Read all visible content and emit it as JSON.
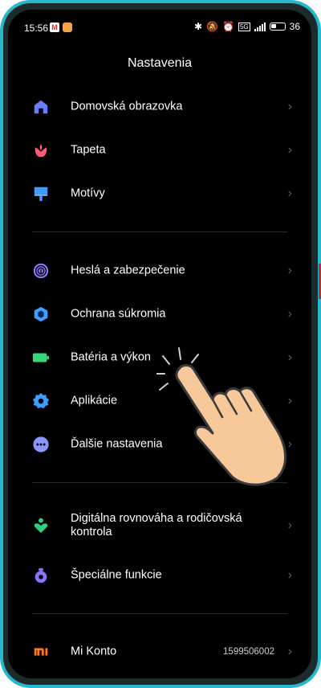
{
  "status_bar": {
    "time": "15:56",
    "network": "5G",
    "battery": "36"
  },
  "header": {
    "title": "Nastavenia"
  },
  "groups": [
    {
      "items": [
        {
          "label": "Domovská obrazovka",
          "icon": "home-icon",
          "color": "#6b7bff"
        },
        {
          "label": "Tapeta",
          "icon": "flower-icon",
          "color": "#ff5a78"
        },
        {
          "label": "Motívy",
          "icon": "brush-icon",
          "color": "#3d9cff"
        }
      ]
    },
    {
      "items": [
        {
          "label": "Heslá a zabezpečenie",
          "icon": "fingerprint-icon",
          "color": "#8a7bff"
        },
        {
          "label": "Ochrana súkromia",
          "icon": "privacy-icon",
          "color": "#3da0ff"
        },
        {
          "label": "Batéria a výkon",
          "icon": "battery-icon",
          "color": "#36d67a"
        },
        {
          "label": "Aplikácie",
          "icon": "gear-icon",
          "color": "#3d9cff"
        },
        {
          "label": "Ďalšie nastavenia",
          "icon": "more-icon",
          "color": "#8c95ff"
        }
      ]
    },
    {
      "items": [
        {
          "label": "Digitálna rovnováha a rodičovská kontrola",
          "icon": "parental-icon",
          "color": "#2fcf7d"
        },
        {
          "label": "Špeciálne funkcie",
          "icon": "special-features-icon",
          "color": "#8a72ff"
        }
      ]
    },
    {
      "items": [
        {
          "label": "Mi Konto",
          "value": "1599506002",
          "icon": "mi-logo-icon",
          "color": "#ff7a1a"
        }
      ]
    }
  ]
}
